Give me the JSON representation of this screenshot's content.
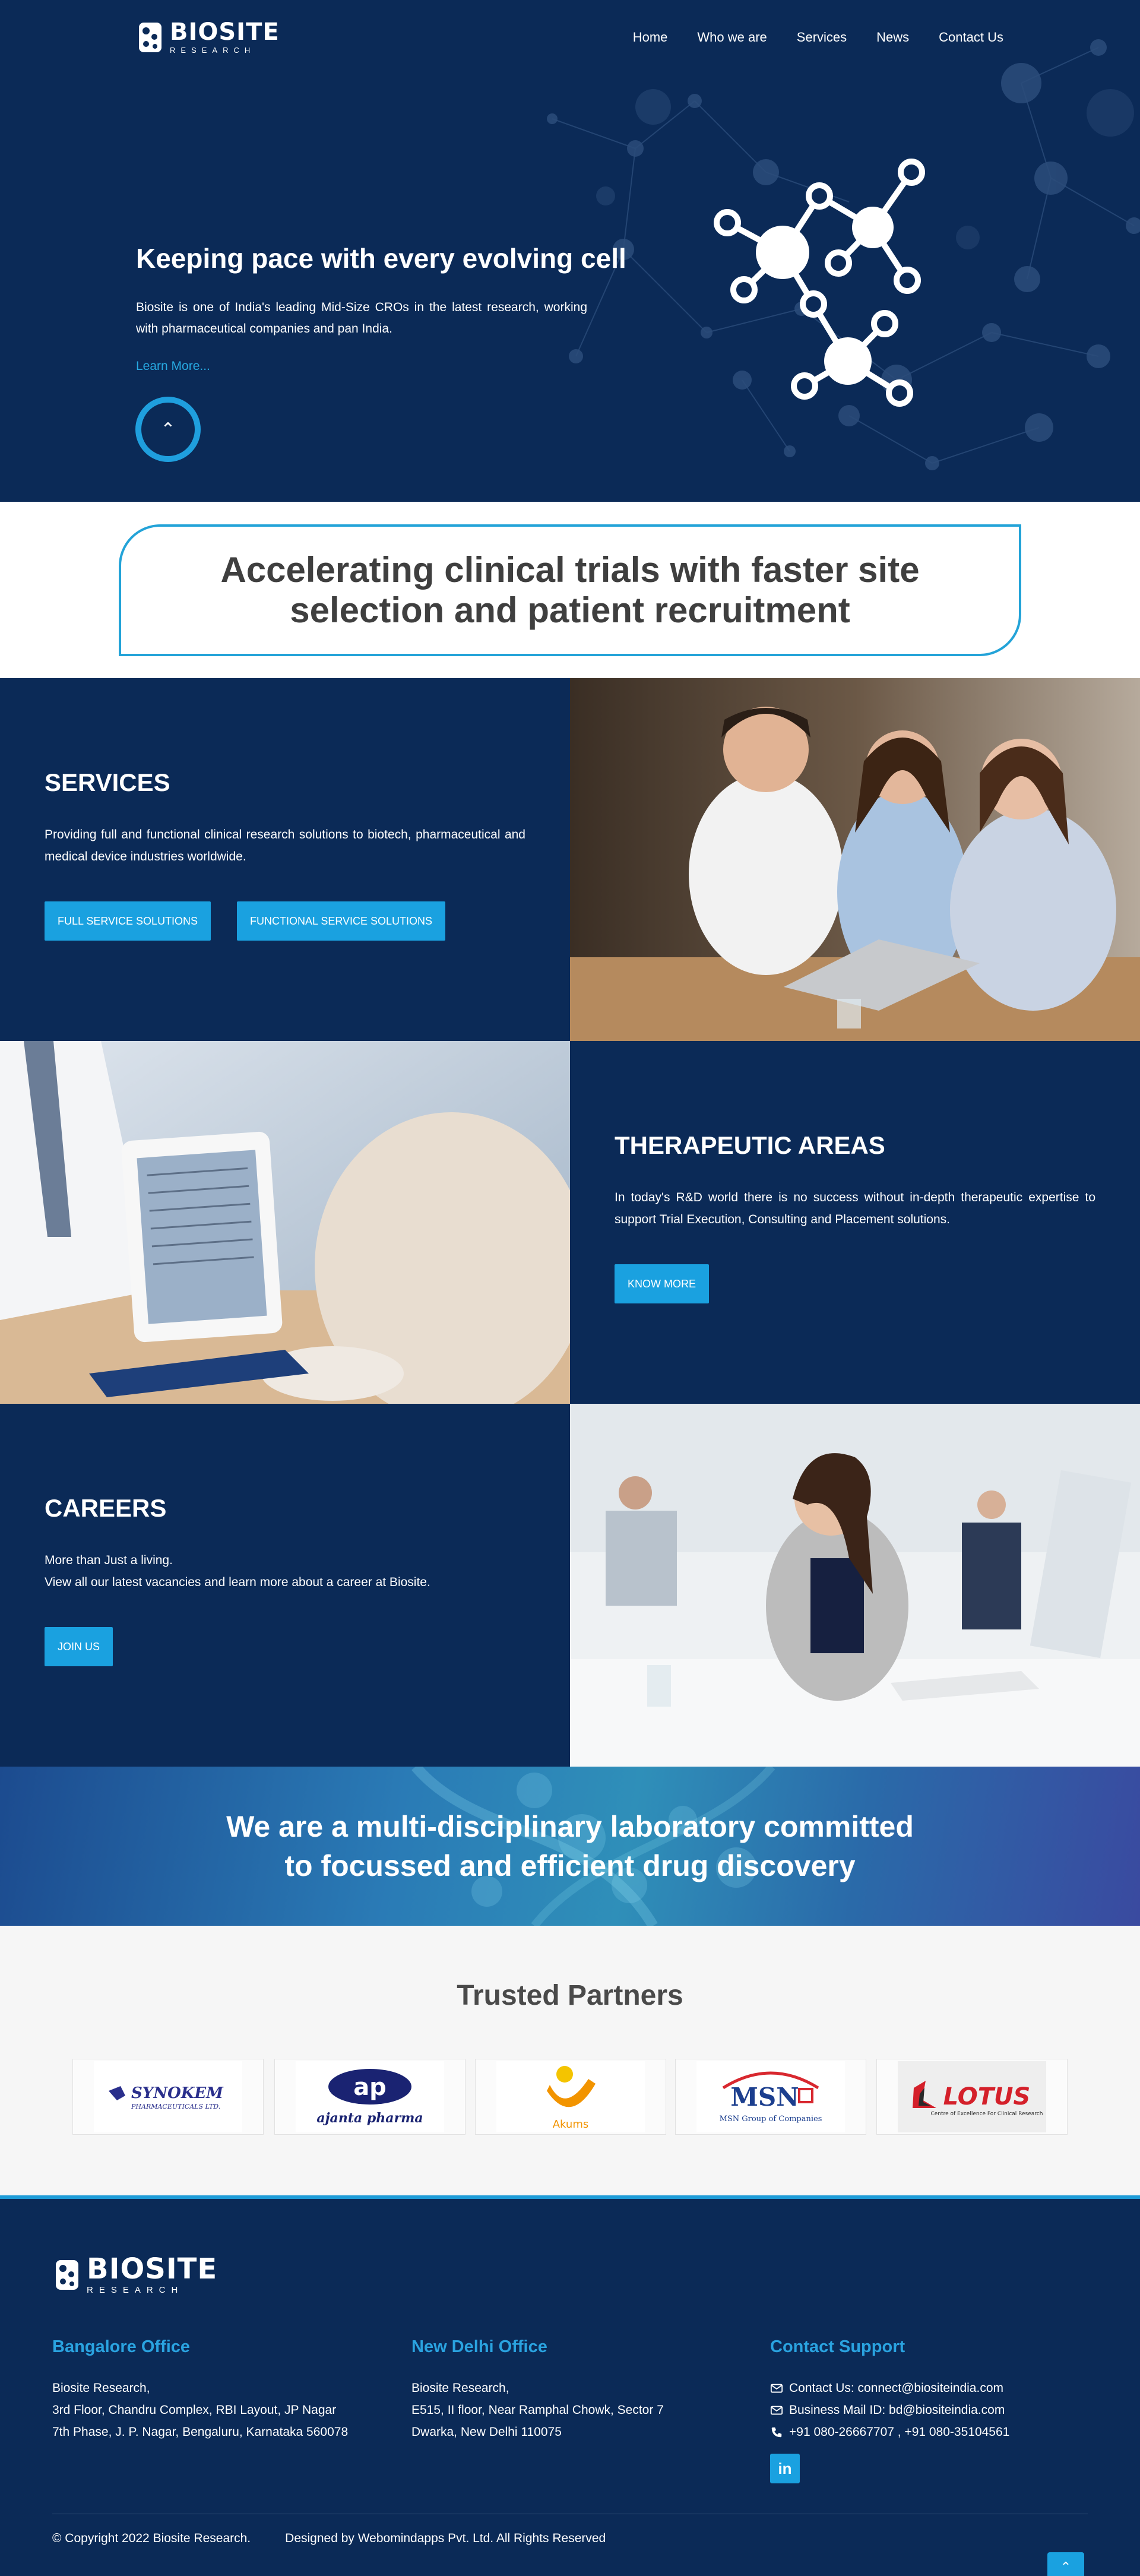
{
  "brand": {
    "name": "BIOSITE",
    "tagline": "RESEARCH"
  },
  "nav": {
    "items": [
      "Home",
      "Who we are",
      "Services",
      "News",
      "Contact Us"
    ]
  },
  "hero": {
    "title": "Keeping pace with every evolving cell",
    "text": "Biosite is one of India's leading Mid-Size CROs in the latest research, working with pharmaceutical companies and pan India.",
    "link": "Learn More...",
    "scroll_icon": "chevron-up-icon"
  },
  "banner": {
    "text": "Accelerating clinical trials with faster site selection and patient recruitment"
  },
  "services": {
    "title": "SERVICES",
    "text": "Providing full and functional clinical research solutions to biotech, pharmaceutical and medical device industries worldwide.",
    "buttons": [
      "FULL SERVICE SOLUTIONS",
      "FUNCTIONAL SERVICE SOLUTIONS"
    ]
  },
  "therapeutic": {
    "title": "THERAPEUTIC AREAS",
    "text": "In today's R&D world there is no success without in-depth therapeutic expertise to support Trial Execution, Consulting and Placement solutions.",
    "button": "KNOW MORE"
  },
  "careers": {
    "title": "CAREERS",
    "line1": "More than Just a living.",
    "line2": "View all our latest vacancies and learn more about a career at Biosite.",
    "button": "JOIN US"
  },
  "lab": {
    "text": "We are a multi-disciplinary laboratory committed to focussed and efficient drug discovery"
  },
  "partners": {
    "title": "Trusted Partners",
    "logos": [
      {
        "name": "SYNOKEM",
        "sub": "PHARMACEUTICALS LTD."
      },
      {
        "name": "ap",
        "sub": "ajanta pharma"
      },
      {
        "name": "Akums",
        "sub": ""
      },
      {
        "name": "MSN",
        "sub": "MSN Group of Companies"
      },
      {
        "name": "LOTUS",
        "sub": "Centre of Excellence For Clinical Research"
      }
    ]
  },
  "footer": {
    "bangalore": {
      "heading": "Bangalore Office",
      "lines": [
        "Biosite Research,",
        "3rd Floor, Chandru Complex, RBI Layout, JP Nagar",
        "7th Phase, J. P. Nagar, Bengaluru, Karnataka 560078"
      ]
    },
    "delhi": {
      "heading": "New Delhi Office",
      "lines": [
        "Biosite Research,",
        "E515, II floor, Near Ramphal Chowk, Sector 7",
        "Dwarka, New Delhi 110075"
      ]
    },
    "support": {
      "heading": "Contact Support",
      "contact": "Contact Us: connect@biositeindia.com",
      "business": "Business Mail ID: bd@biositeindia.com",
      "phone": "+91 080-26667707 , +91 080-35104561",
      "linkedin": "in"
    },
    "copyright": "© Copyright 2022 Biosite Research.",
    "designed": "Designed by Webomindapps Pvt. Ltd.  All Rights Reserved"
  },
  "colors": {
    "navy": "#0b2a57",
    "accent": "#1aa1e0",
    "banner_border": "#23a3d8"
  }
}
